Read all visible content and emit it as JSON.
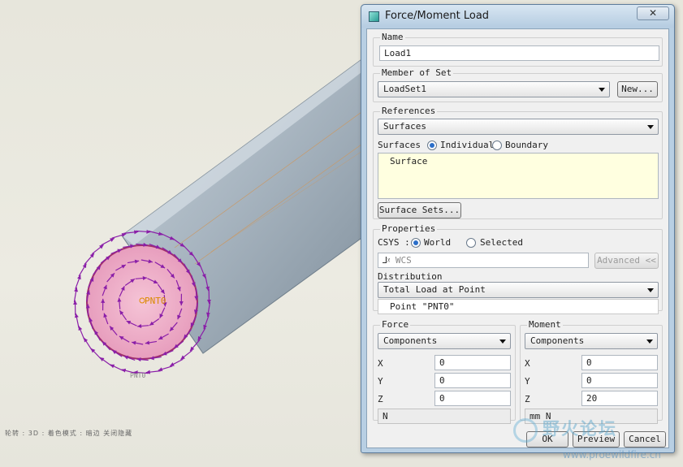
{
  "viewport": {
    "point_label": "PNT0",
    "point_sub_label": "PNT0",
    "status_text": "轮转 : 3D : 着色模式 : 暗边 关闭隐藏"
  },
  "dialog": {
    "title": "Force/Moment Load",
    "close_glyph": "✕",
    "name": {
      "label": "Name",
      "value": "Load1"
    },
    "member_of_set": {
      "label": "Member of Set",
      "value": "LoadSet1",
      "new_button": "New..."
    },
    "references": {
      "label": "References",
      "type": "Surfaces",
      "surfaces_label": "Surfaces :",
      "individual_label": "Individual",
      "boundary_label": "Boundary",
      "selected_option": "Individual",
      "items": [
        "Surface"
      ],
      "surface_sets_button": "Surface Sets..."
    },
    "properties": {
      "label": "Properties",
      "csys_label": "CSYS :",
      "world_label": "World",
      "selected_label": "Selected",
      "csys_selected": "World",
      "csys_value": "WCS",
      "advanced_button": "Advanced <<",
      "distribution_label": "Distribution",
      "distribution_value": "Total Load at Point",
      "point_value": "Point \"PNT0\""
    },
    "force": {
      "label": "Force",
      "mode": "Components",
      "x_label": "X",
      "x": "0",
      "y_label": "Y",
      "y": "0",
      "z_label": "Z",
      "z": "0",
      "units": "N"
    },
    "moment": {
      "label": "Moment",
      "mode": "Components",
      "x_label": "X",
      "x": "0",
      "y_label": "Y",
      "y": "0",
      "z_label": "Z",
      "z": "20",
      "units": "mm N"
    },
    "buttons": {
      "ok": "OK",
      "preview": "Preview",
      "cancel": "Cancel"
    }
  },
  "watermark": {
    "text": "野火论坛",
    "url": "www.proewildfire.cn"
  },
  "colors": {
    "arrow": "#8a1ea8",
    "point": "#e08a00",
    "cylinder": "#aebac4"
  }
}
